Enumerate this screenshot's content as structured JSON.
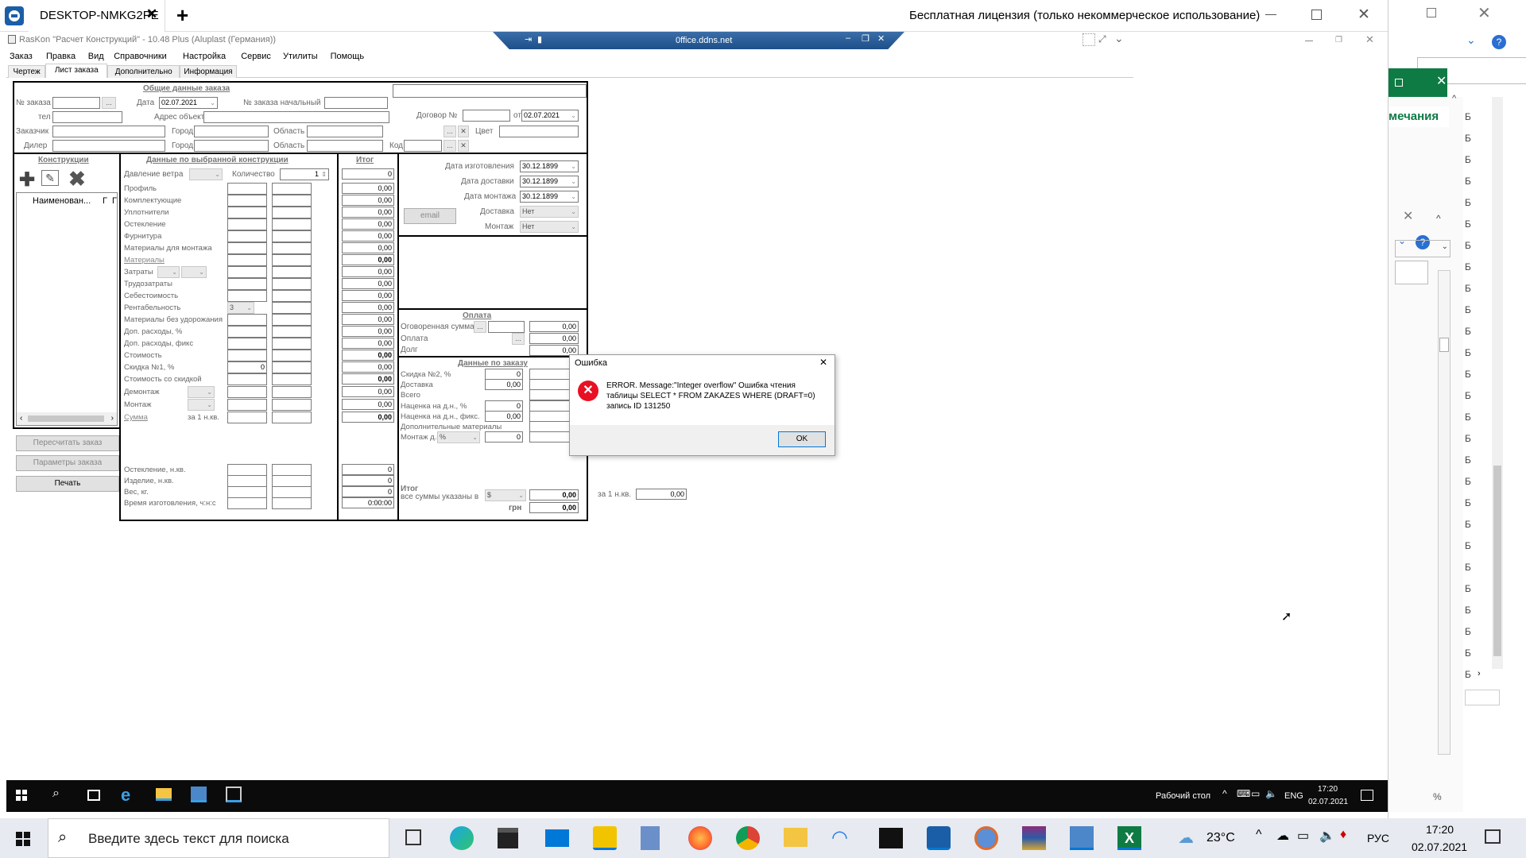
{
  "tv": {
    "tab_title": "DESKTOP-NMKG2PE",
    "license_text": "Бесплатная лицензия (только некоммерческое использование)",
    "remote_bar_title": "0ffice.ddns.net"
  },
  "app": {
    "title": "RasKon \"Расчет Конструкций\" - 10.48 Plus (Aluplast  (Германия))",
    "menu": [
      "Заказ",
      "Правка",
      "Вид",
      "Справочники",
      "Настройка",
      "Сервис",
      "Утилиты",
      "Помощь"
    ],
    "tabs": [
      "Чертеж",
      "Лист заказа",
      "Дополнительно",
      "Информация"
    ]
  },
  "order": {
    "section_title": "Общие данные заказа",
    "order_no_label": "№ заказа",
    "date_label": "Дата",
    "date_value": "02.07.2021",
    "start_no_label": "№ заказа начальный",
    "contract_label": "Договор №",
    "from_label": "от",
    "contract_date": "02.07.2021",
    "tel_label": "тел",
    "address_label": "Адрес объекта",
    "customer_label": "Заказчик",
    "city_label": "Город",
    "region_label": "Область",
    "color_label": "Цвет",
    "dealer_label": "Дилер",
    "code_label": "Код"
  },
  "constructions": {
    "title": "Конструкции",
    "col_name": "Наименован...",
    "col_g": "Г",
    "col_p": "Г",
    "recalc_button": "Пересчитать заказ",
    "params_button": "Параметры заказа",
    "print_button": "Печать"
  },
  "selected": {
    "title": "Данные по выбранной конструкции",
    "wind_label": "Давление ветра",
    "qty_label": "Количество",
    "qty_value": "1",
    "rows": [
      "Профиль",
      "Комплектующие",
      "Уплотнители",
      "Остекление",
      "Фурнитура",
      "Материалы для монтажа",
      "Материалы",
      "Затраты",
      "Трудозатраты",
      "Себестоимость",
      "Рентабельность",
      "Материалы без удорожания",
      "Доп. расходы, %",
      "Доп. расходы, фикс",
      "Стоимость",
      "Скидка №1, %",
      "Стоимость со скидкой",
      "Демонтаж",
      "Монтаж",
      "Сумма"
    ],
    "profit_value": "3",
    "discount_value": "0",
    "per_sqm": "за 1 н.кв.",
    "bottom_rows": [
      "Остекление, н.кв.",
      "Изделие, н.кв.",
      "Вес, кг.",
      "Время изготовления, ч:н:с"
    ]
  },
  "totals": {
    "title": "Итог",
    "first": "0",
    "values": [
      "0,00",
      "0,00",
      "0,00",
      "0,00",
      "0,00",
      "0,00",
      "0,00",
      "0,00",
      "0,00",
      "0,00",
      "0,00",
      "0,00",
      "0,00",
      "0,00",
      "0,00",
      "0,00",
      "0,00",
      "0,00",
      "0,00",
      "0,00"
    ],
    "bold_rows": [
      6,
      14,
      16,
      19
    ],
    "bottom_values": [
      "0",
      "0",
      "0",
      "0:00:00"
    ]
  },
  "dates": {
    "make_label": "Дата изготовления",
    "make_value": "30.12.1899",
    "delivery_label": "Дата доставки",
    "delivery_value": "30.12.1899",
    "mount_label": "Дата монтажа",
    "mount_value": "30.12.1899",
    "email_button": "email",
    "delivery2_label": "Доставка",
    "delivery2_value": "Нет",
    "mounting_label": "Монтаж",
    "mounting_value": "Нет"
  },
  "payment": {
    "title": "Оплата",
    "agreed_label": "Оговоренная сумма",
    "agreed_value": "0,00",
    "paid_label": "Оплата",
    "paid_value": "0,00",
    "debt_label": "Долг",
    "debt_value": "0,00"
  },
  "order_data": {
    "title": "Данные по заказу",
    "rows": [
      "Скидка №2, %",
      "Доставка",
      "Всего",
      "Наценка на д.н., %",
      "Наценка на д.н., фикс.",
      "Дополнительные материалы",
      "Монтаж д.н."
    ],
    "left_vals": [
      "0",
      "0,00",
      "",
      "0",
      "0,00",
      "",
      ""
    ],
    "right_vals": [
      "0",
      "0",
      "0",
      "0",
      "0",
      "0",
      "0"
    ],
    "percent_unit": "%",
    "monthly_value": "0",
    "total_label": "Итог",
    "currency_note": "все суммы указаны в",
    "currency": "$",
    "total_usd": "0,00",
    "uah_label": "грн",
    "total_uah": "0,00",
    "per_sqm_label": "за 1 н.кв.",
    "per_sqm_value": "0,00"
  },
  "dialog": {
    "title": "Ошибка",
    "message": "ERROR. Message:\"Integer overflow\" Ошибка чтения таблицы SELECT * FROM ZAKAZES WHERE (DRAFT=0) запись ID 131250",
    "ok": "OK"
  },
  "right_panel": {
    "header": "мечания",
    "letters": [
      "Б",
      "Б",
      "Б",
      "Б",
      "Б",
      "Б",
      "Б",
      "Б",
      "Б",
      "Б",
      "Б",
      "Б",
      "Б",
      "Б",
      "Б",
      "Б",
      "Б",
      "Б",
      "Б",
      "Б",
      "Б",
      "Б",
      "Б",
      "Б",
      "Б",
      "Б",
      "Б"
    ],
    "zoom": "%"
  },
  "remote_taskbar": {
    "desktop_label": "Рабочий стол",
    "lang": "ENG",
    "time": "17:20",
    "date": "02.07.2021"
  },
  "taskbar": {
    "search_placeholder": "Введите здесь текст для поиска",
    "temperature": "23°C",
    "lang": "РУС",
    "time": "17:20",
    "date": "02.07.2021"
  },
  "colors": {
    "accent": "#0f7b44",
    "tv_blue": "#1a5ea8",
    "taskbar": "#e7eaf0",
    "remote_taskbar": "#0b0b0b"
  }
}
